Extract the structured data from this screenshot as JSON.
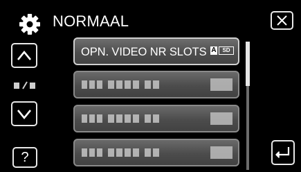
{
  "header": {
    "title": "NORMAAL",
    "icon": "gear-icon"
  },
  "menu": {
    "items": [
      {
        "label": "OPN. VIDEO NR SLOTS",
        "badges": [
          "A",
          "SD"
        ],
        "state": "active"
      },
      {
        "label": "",
        "state": "placeholder"
      },
      {
        "label": "",
        "state": "placeholder"
      },
      {
        "label": "",
        "state": "placeholder"
      }
    ],
    "page_indicator": "1/1 (obscured)"
  },
  "nav": {
    "up": "chevron-up-icon",
    "down": "chevron-down-icon",
    "help": "?",
    "close": "close-icon",
    "back": "return-icon"
  },
  "colors": {
    "background": "#000000",
    "button_border": "#e8e8e8",
    "item_fill": "#555555",
    "text": "#ffffff"
  }
}
